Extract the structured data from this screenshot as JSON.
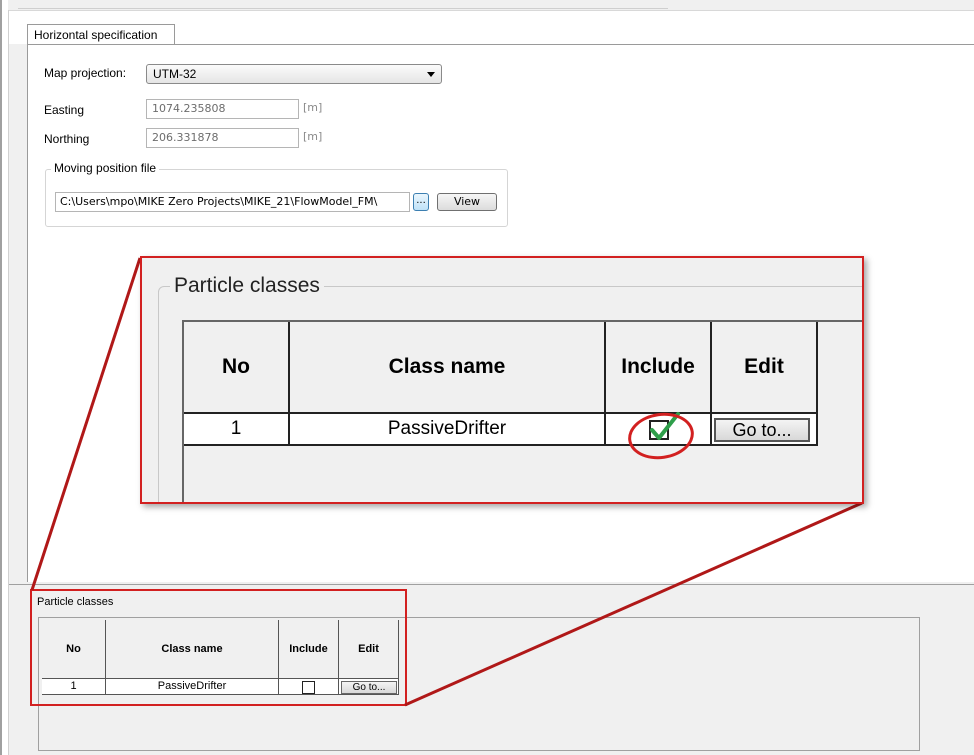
{
  "tab": {
    "label": "Horizontal specification"
  },
  "map_projection": {
    "label": "Map projection:",
    "value": "UTM-32"
  },
  "easting": {
    "label": "Easting",
    "value": "1074.235808",
    "unit": "[m]"
  },
  "northing": {
    "label": "Northing",
    "value": "206.331878",
    "unit": "[m]"
  },
  "moving_position": {
    "title": "Moving position file",
    "path": "C:\\Users\\mpo\\MIKE Zero Projects\\MIKE_21\\FlowModel_FM\\",
    "browse_label": "...",
    "view_label": "View"
  },
  "zoom_panel": {
    "title": "Particle classes",
    "headers": {
      "no": "No",
      "class_name": "Class name",
      "include": "Include",
      "edit": "Edit"
    },
    "row": {
      "no": "1",
      "class_name": "PassiveDrifter",
      "include": true,
      "edit": "Go to..."
    }
  },
  "particle_classes": {
    "title": "Particle classes",
    "headers": {
      "no": "No",
      "class_name": "Class name",
      "include": "Include",
      "edit": "Edit"
    },
    "row": {
      "no": "1",
      "class_name": "PassiveDrifter",
      "include": false,
      "edit": "Go to..."
    }
  },
  "colors": {
    "highlight": "#d22020",
    "check": "#2e9e4a",
    "panel_bg": "#f0f0f0"
  }
}
